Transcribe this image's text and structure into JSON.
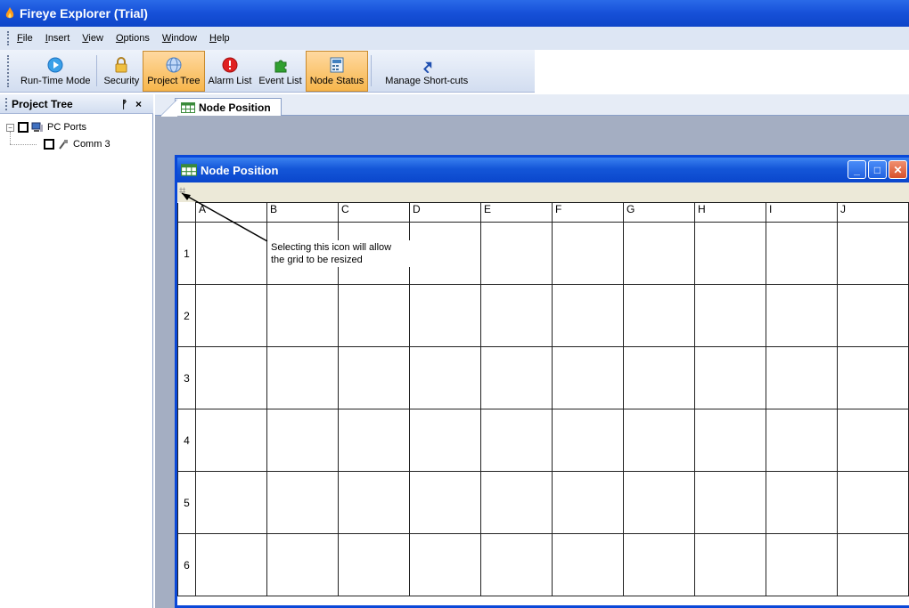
{
  "app": {
    "title": "Fireye Explorer (Trial)"
  },
  "menu": [
    {
      "label_pre": "",
      "label_u": "F",
      "label_post": "ile"
    },
    {
      "label_pre": "",
      "label_u": "I",
      "label_post": "nsert"
    },
    {
      "label_pre": "",
      "label_u": "V",
      "label_post": "iew"
    },
    {
      "label_pre": "",
      "label_u": "O",
      "label_post": "ptions"
    },
    {
      "label_pre": "",
      "label_u": "W",
      "label_post": "indow"
    },
    {
      "label_pre": "",
      "label_u": "H",
      "label_post": "elp"
    }
  ],
  "toolbar": {
    "run_time_mode": "Run-Time Mode",
    "security": "Security",
    "project_tree": "Project Tree",
    "alarm_list": "Alarm List",
    "event_list": "Event List",
    "node_status": "Node Status",
    "manage_shortcuts": "Manage Short-cuts",
    "active_items": [
      "Project Tree",
      "Node Status"
    ]
  },
  "project_tree": {
    "title": "Project Tree",
    "pin": "ᚡ",
    "close": "×",
    "expander": "−",
    "nodes": [
      {
        "label": "PC Ports"
      },
      {
        "label": "Comm 3"
      }
    ]
  },
  "document": {
    "tab_label": "Node Position",
    "window_title": "Node Position",
    "columns": [
      "A",
      "B",
      "C",
      "D",
      "E",
      "F",
      "G",
      "H",
      "I",
      "J"
    ],
    "rows": [
      "1",
      "2",
      "3",
      "4",
      "5",
      "6"
    ],
    "callout_line1": "Selecting this icon will allow",
    "callout_line2": "the grid to be resized",
    "window_buttons": {
      "minimize": "_",
      "maximize": "□",
      "close": "✕"
    }
  },
  "colors": {
    "title_blue": "#1650d8",
    "toolbar_active": "#f7b64c",
    "grid_line": "#222222"
  }
}
